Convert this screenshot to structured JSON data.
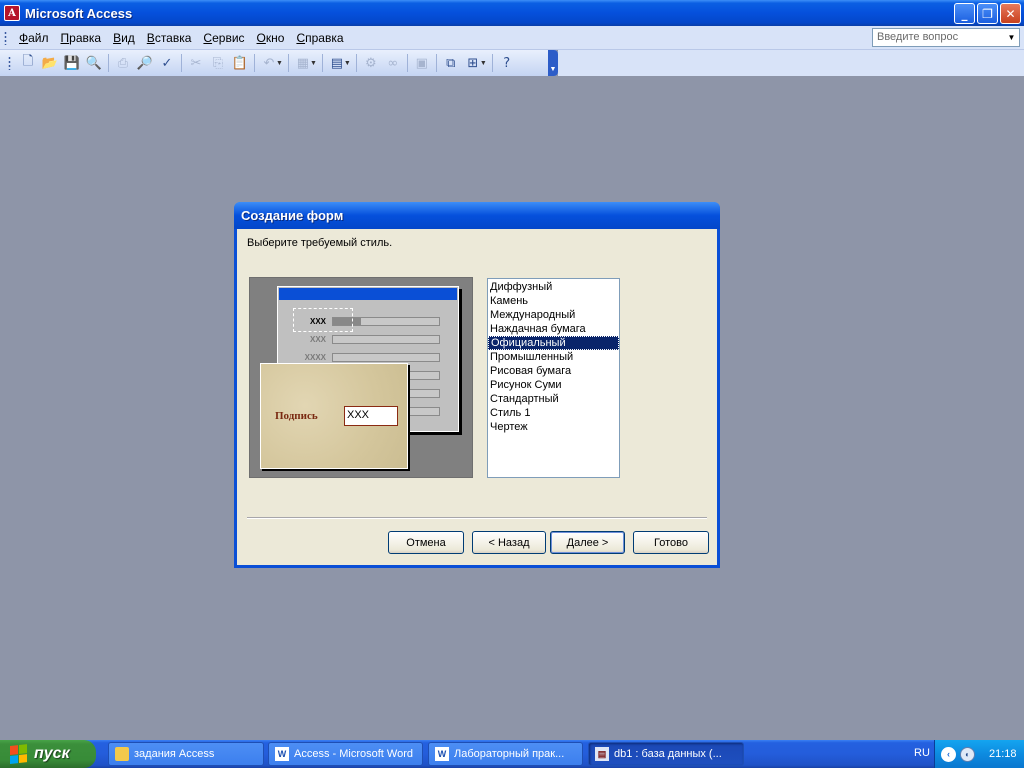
{
  "window": {
    "title": "Microsoft Access",
    "app_icon": "access-icon",
    "controls": [
      "minimize-icon",
      "restore-icon",
      "close-icon"
    ]
  },
  "menu": {
    "items": [
      "Файл",
      "Правка",
      "Вид",
      "Вставка",
      "Сервис",
      "Окно",
      "Справка"
    ],
    "help_placeholder": "Введите вопрос"
  },
  "toolbar": {
    "icons": [
      "new-icon",
      "open-icon",
      "save-icon",
      "file-search-icon",
      "print-icon",
      "print-preview-icon",
      "spelling-icon",
      "cut-icon",
      "copy-icon",
      "paste-icon",
      "undo-icon",
      "office-links-icon",
      "analyze-icon",
      "code-icon",
      "script-icon",
      "properties-icon",
      "relationships-icon",
      "new-object-icon",
      "help-icon"
    ]
  },
  "dialog": {
    "title": "Создание форм",
    "prompt": "Выберите требуемый стиль.",
    "preview": {
      "labels": [
        "XXX",
        "XXX",
        "XXXX"
      ],
      "zoom_label": "Подпись",
      "zoom_field": "XXX"
    },
    "styles": [
      "Диффузный",
      "Камень",
      "Международный",
      "Наждачная бумага",
      "Официальный",
      "Промышленный",
      "Рисовая бумага",
      "Рисунок Суми",
      "Стандартный",
      "Стиль 1",
      "Чертеж"
    ],
    "selected_style": "Официальный",
    "buttons": {
      "cancel": "Отмена",
      "back": "< Назад",
      "next": "Далее >",
      "finish": "Готово"
    }
  },
  "taskbar": {
    "start": "пуск",
    "tasks": [
      {
        "label": "задания Access",
        "icon": "folder-icon"
      },
      {
        "label": "Access - Microsoft Word",
        "icon": "word-icon"
      },
      {
        "label": "Лабораторный прак...",
        "icon": "word-icon"
      },
      {
        "label": "db1 : база данных (...",
        "icon": "access-db-icon"
      }
    ],
    "language": "RU",
    "clock": "21:18"
  },
  "colors": {
    "title_blue": "#0550dc",
    "desktop_mdi": "#8e95a8",
    "dialog_face": "#ece9d8",
    "selection": "#0a246a",
    "start_green": "#388c38"
  }
}
